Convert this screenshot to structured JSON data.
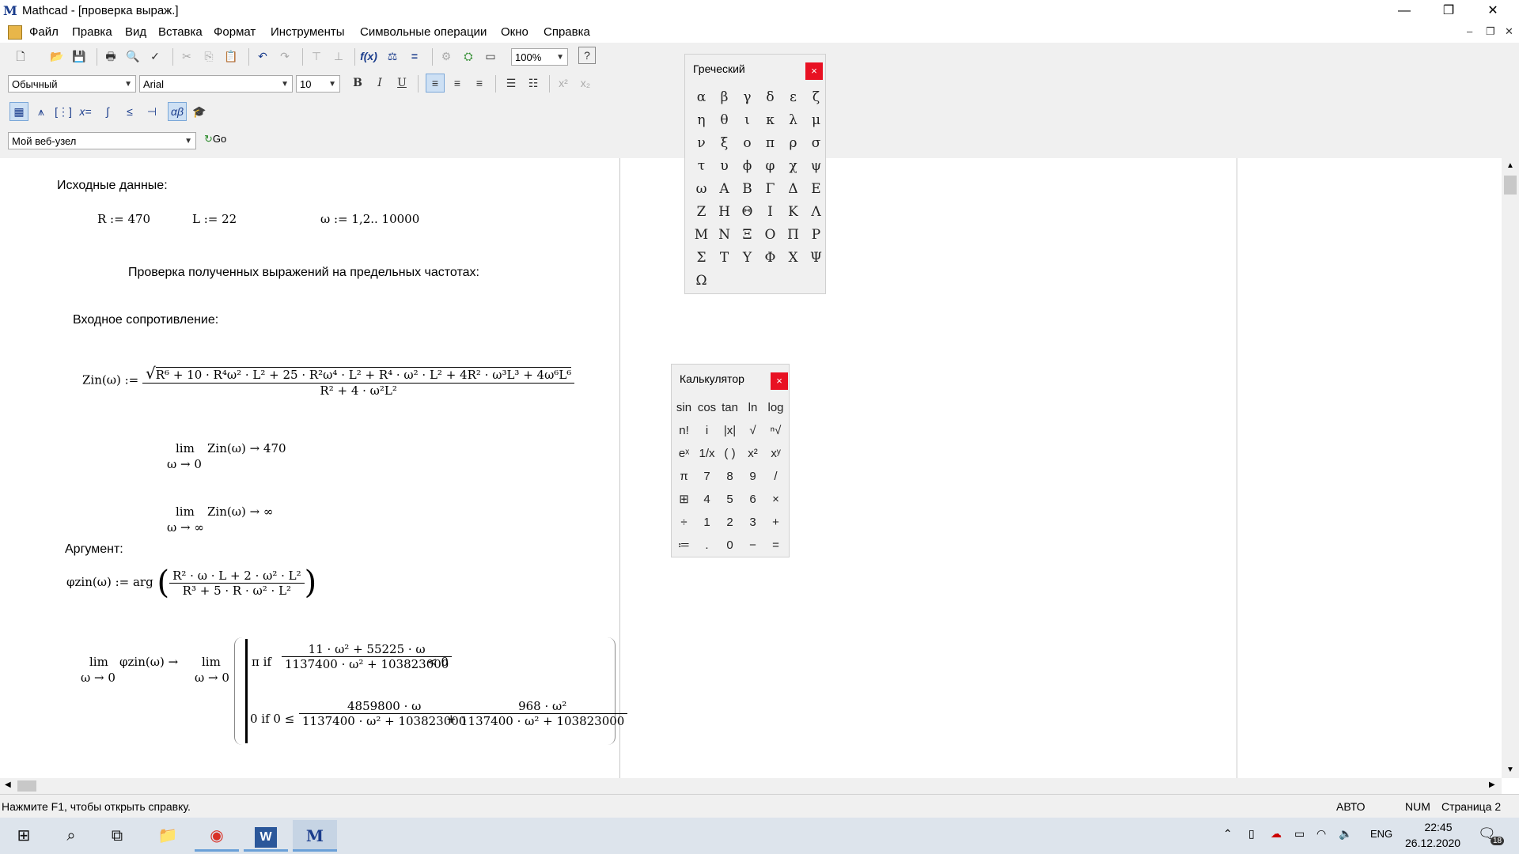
{
  "window": {
    "title": "Mathcad - [проверка выраж.]",
    "logo": "M"
  },
  "menu": [
    "Файл",
    "Правка",
    "Вид",
    "Вставка",
    "Формат",
    "Инструменты",
    "Символьные операции",
    "Окно",
    "Справка"
  ],
  "toolbar": {
    "zoom": "100%",
    "style": "Обычный",
    "font": "Arial",
    "size": "10",
    "bold": "B",
    "italic": "I",
    "underline": "U",
    "web_site": "Мой веб-узел",
    "go": "Go"
  },
  "doc": {
    "initial_data_label": "Исходные данные:",
    "R_def": "R := 470",
    "L_def": "L := 22",
    "w_def": "ω := 1,2.. 10000",
    "check_heading": "Проверка полученных выражений на предельных частотах:",
    "input_res_label": "Входное сопротивление:",
    "zin_lhs": "Zin(ω) :=",
    "zin_num": "R⁶ + 10 · R⁴ω² · L² + 25 · R²ω⁴ · L² + R⁴ · ω² · L² + 4R² · ω³L³ + 4ω⁶L⁶",
    "zin_den": "R² + 4 · ω²L²",
    "lim1_op": "lim",
    "lim1_sub": "ω → 0",
    "lim1_expr": "Zin(ω)  → 470",
    "lim2_op": "lim",
    "lim2_sub": "ω → ∞",
    "lim2_expr": "Zin(ω)  → ∞",
    "arg_label": "Аргумент:",
    "phi_lhs": "φzin(ω) := arg",
    "phi_num": "R² · ω · L + 2 · ω² · L²",
    "phi_den": "R³ + 5 · R · ω² · L²",
    "lim3_op": "lim",
    "lim3_sub": "ω → 0",
    "lim3_expr": "φzin(ω)  →",
    "lim3b_op": "lim",
    "lim3b_sub": "ω → 0",
    "case1_val": "π  if",
    "case1_num": "11 · ω² + 55225 · ω",
    "case1_den": "1137400 · ω² + 103823000",
    "case1_cmp": "< 0",
    "case2_val": "0  if  0 ≤",
    "case2_num1": "4859800 · ω",
    "case2_den1": "1137400 · ω² + 103823000",
    "case2_plus": "+",
    "case2_num2": "968 · ω²",
    "case2_den2": "1137400 · ω² + 103823000"
  },
  "greek": {
    "title": "Греческий",
    "close": "×",
    "symbols": [
      "α",
      "β",
      "γ",
      "δ",
      "ε",
      "ζ",
      "η",
      "θ",
      "ι",
      "κ",
      "λ",
      "μ",
      "ν",
      "ξ",
      "ο",
      "π",
      "ρ",
      "σ",
      "τ",
      "υ",
      "ϕ",
      "φ",
      "χ",
      "ψ",
      "ω",
      "Α",
      "Β",
      "Γ",
      "Δ",
      "Ε",
      "Ζ",
      "Η",
      "Θ",
      "Ι",
      "Κ",
      "Λ",
      "Μ",
      "Ν",
      "Ξ",
      "Ο",
      "Π",
      "Ρ",
      "Σ",
      "Τ",
      "Υ",
      "Φ",
      "Χ",
      "Ψ",
      "Ω"
    ]
  },
  "calc": {
    "title": "Калькулятор",
    "close": "×",
    "keys": [
      "sin",
      "cos",
      "tan",
      "ln",
      "log",
      "n!",
      "i",
      "|x|",
      "√",
      "ⁿ√",
      "eˣ",
      "1/x",
      "( )",
      "x²",
      "xʸ",
      "π",
      "7",
      "8",
      "9",
      "/",
      "⊞",
      "4",
      "5",
      "6",
      "×",
      "÷",
      "1",
      "2",
      "3",
      "+",
      "≔",
      ".",
      "0",
      "−",
      "="
    ]
  },
  "status": {
    "help": "Нажмите F1, чтобы открыть справку.",
    "mode": "АВТО",
    "num": "NUM",
    "page": "Страница 2"
  },
  "taskbar": {
    "lang": "ENG",
    "time": "22:45",
    "date": "26.12.2020",
    "notif": "18"
  }
}
